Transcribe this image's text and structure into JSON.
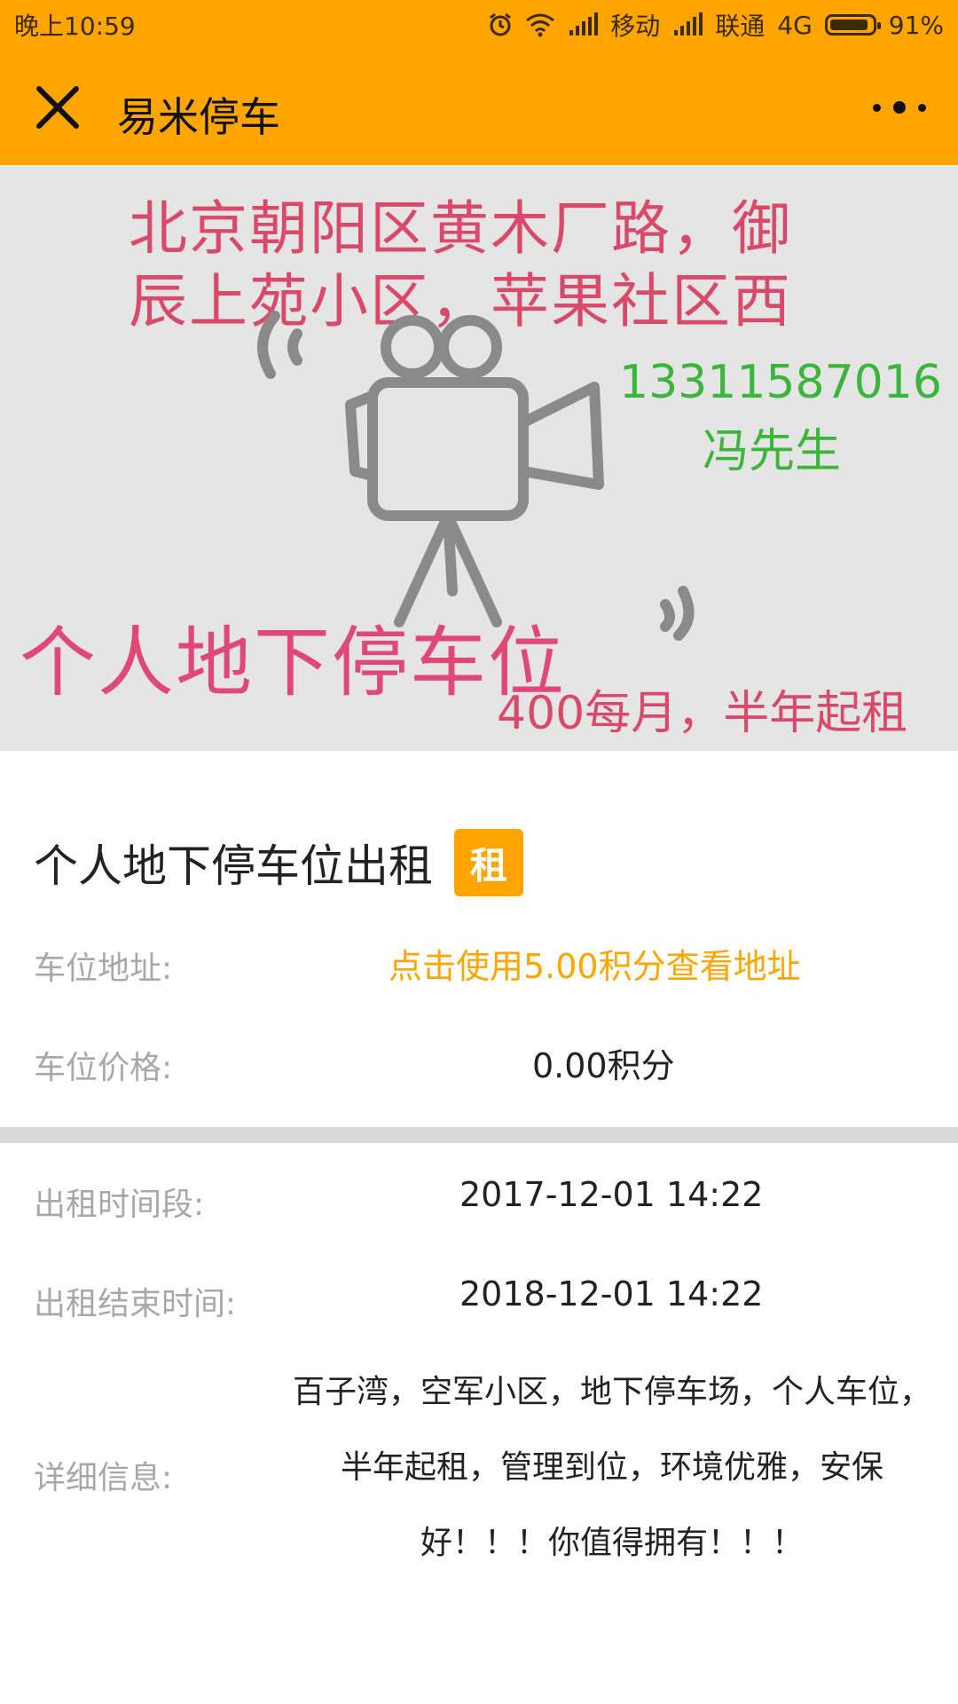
{
  "status_bar": {
    "time": "晚上10:59",
    "carrier1": "移动",
    "carrier2": "联通",
    "network": "4G",
    "battery": "91%",
    "battery_level": 0.91
  },
  "titlebar": {
    "title": "易米停车"
  },
  "banner": {
    "address_line1": "北京朝阳区黄木厂路，御",
    "address_line2": "辰上苑小区，苹果社区西",
    "phone": "13311587016",
    "contact": "冯先生",
    "headline": "个人地下停车位",
    "price_text": "400每月，半年起租"
  },
  "listing": {
    "title": "个人地下停车位出租",
    "badge": "租",
    "address_label": "车位地址:",
    "address_action": "点击使用5.00积分查看地址",
    "price_label": "车位价格:",
    "price_value": "0.00积分",
    "period_label": "出租时间段:",
    "period_value": "2017-12-01 14:22",
    "end_label": "出租结束时间:",
    "end_value": "2018-12-01 14:22",
    "detail_label": "详细信息:",
    "detail_value": "百子湾，空军小区，地下停车场，个人车位，半年起租，管理到位，环境优雅，安保好！！！你值得拥有！！！"
  },
  "colors": {
    "accent": "#FFA500",
    "label": "#a8a8a8",
    "banner_red": "#d94a6a",
    "banner_green": "#3cb53c"
  },
  "icons": [
    "alarm-icon",
    "wifi-icon",
    "signal-icon",
    "battery-icon",
    "close-icon",
    "more-icon",
    "camera-icon"
  ]
}
